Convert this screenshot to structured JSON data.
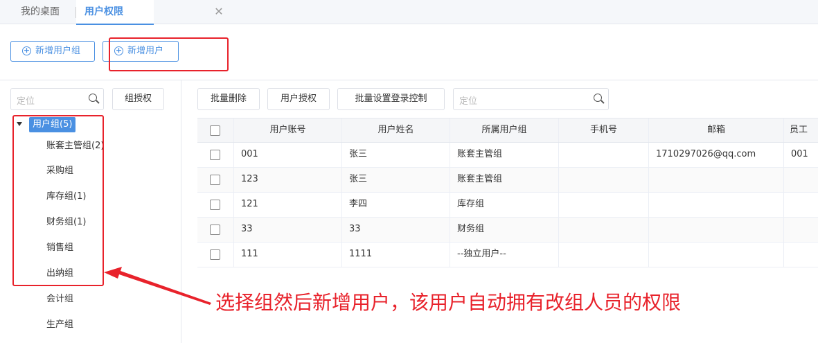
{
  "tabs": [
    {
      "label": "我的桌面"
    },
    {
      "label": "用户权限"
    }
  ],
  "tab_close": "✕",
  "toolbar": {
    "add_group_label": "新增用户组",
    "add_user_label": "新增用户"
  },
  "left": {
    "search_placeholder": "定位",
    "group_auth_label": "组授权",
    "tree_root": "用户组(5)",
    "tree_items": [
      "账套主管组(2)",
      "采购组",
      "库存组(1)",
      "财务组(1)",
      "销售组",
      "出纳组",
      "会计组",
      "生产组"
    ]
  },
  "right": {
    "batch_delete_label": "批量删除",
    "user_auth_label": "用户授权",
    "batch_login_label": "批量设置登录控制",
    "search_placeholder": "定位",
    "columns": [
      "用户账号",
      "用户姓名",
      "所属用户组",
      "手机号",
      "邮箱",
      "员工"
    ],
    "rows": [
      {
        "account": "001",
        "name": "张三",
        "group": "账套主管组",
        "phone": "",
        "email": "1710297026@qq.com",
        "emp": "001"
      },
      {
        "account": "123",
        "name": "张三",
        "group": "账套主管组",
        "phone": "",
        "email": "",
        "emp": ""
      },
      {
        "account": "121",
        "name": "李四",
        "group": "库存组",
        "phone": "",
        "email": "",
        "emp": ""
      },
      {
        "account": "33",
        "name": "33",
        "group": "财务组",
        "phone": "",
        "email": "",
        "emp": ""
      },
      {
        "account": "111",
        "name": "1111",
        "group": "--独立用户--",
        "phone": "",
        "email": "",
        "emp": ""
      }
    ]
  },
  "annotation": "选择组然后新增用户，该用户自动拥有改组人员的权限",
  "colors": {
    "accent": "#4a90e2",
    "annotation_red": "#e8222b"
  }
}
